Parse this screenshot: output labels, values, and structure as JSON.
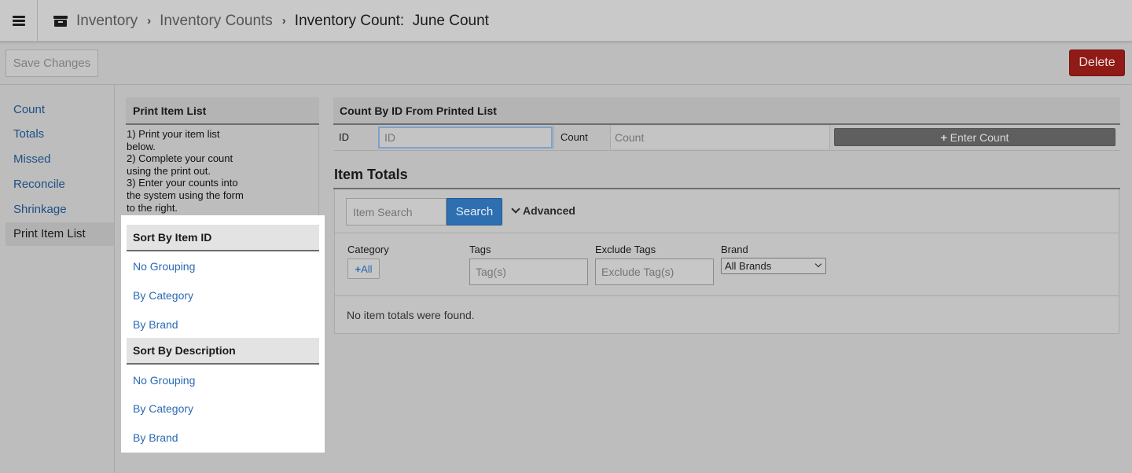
{
  "header": {
    "menu_icon": "hamburger-menu-icon",
    "section_icon": "inventory-box-icon",
    "breadcrumbs": [
      "Inventory",
      "Inventory Counts"
    ],
    "current": "Inventory Count:  June Count"
  },
  "toolbar": {
    "save_label": "Save Changes",
    "delete_label": "Delete",
    "delete_color": "#8f1a16"
  },
  "sidebar": {
    "items": [
      {
        "label": "Count"
      },
      {
        "label": "Totals"
      },
      {
        "label": "Missed"
      },
      {
        "label": "Reconcile"
      },
      {
        "label": "Shrinkage"
      },
      {
        "label": "Print Item List",
        "active": true
      }
    ]
  },
  "print_list": {
    "title": "Print Item List",
    "instructions": "1) Print your item list\nbelow.\n2) Complete your count\nusing the print out.\n3) Enter your counts into\nthe system using the form\nto the right."
  },
  "popup": {
    "sections": [
      {
        "title": "Sort By Item ID",
        "links": [
          "No Grouping",
          "By Category",
          "By Brand"
        ]
      },
      {
        "title": "Sort By Description",
        "links": [
          "No Grouping",
          "By Category",
          "By Brand"
        ]
      }
    ]
  },
  "count_by_id": {
    "title": "Count By ID From Printed List",
    "id_label": "ID",
    "id_placeholder": "ID",
    "count_label": "Count",
    "count_placeholder": "Count",
    "enter_label": "Enter Count"
  },
  "item_totals": {
    "title": "Item Totals",
    "search_placeholder": "Item Search",
    "search_label": "Search",
    "advanced_label": "Advanced",
    "category_label": "Category",
    "all_label": "All",
    "tags_label": "Tags",
    "tags_placeholder": "Tag(s)",
    "exclude_label": "Exclude Tags",
    "exclude_placeholder": "Exclude Tag(s)",
    "brand_label": "Brand",
    "brand_selected": "All Brands",
    "empty_message": "No item totals were found.",
    "accent_color": "#2d6fb0"
  }
}
